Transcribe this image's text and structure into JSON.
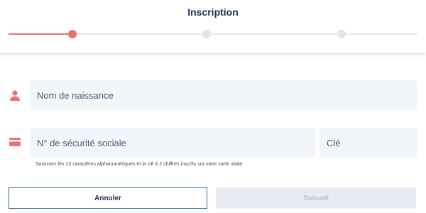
{
  "header": {
    "title": "Inscription",
    "progress": {
      "total_steps": 3,
      "current_step": 1,
      "active_color": "#ef6f73",
      "inactive_color": "#dfe5ec"
    }
  },
  "form": {
    "birth_name": {
      "icon": "person-icon",
      "value": "",
      "placeholder": "Nom de naissance"
    },
    "social_security": {
      "icon": "card-icon",
      "value": "",
      "placeholder": "N° de sécurité sociale"
    },
    "key": {
      "value": "",
      "placeholder": "Clé"
    },
    "help_text": "Saisissez les 13 caractères alphanumériques et la clé à 2 chiffres inscrits sur votre carte vitale"
  },
  "actions": {
    "cancel_label": "Annuler",
    "next_label": "Suivant",
    "next_enabled": false
  },
  "colors": {
    "accent": "#ef6f73",
    "title": "#1e2c52",
    "field_bg": "#f2f5f9",
    "cancel_border": "#2d6d97"
  }
}
